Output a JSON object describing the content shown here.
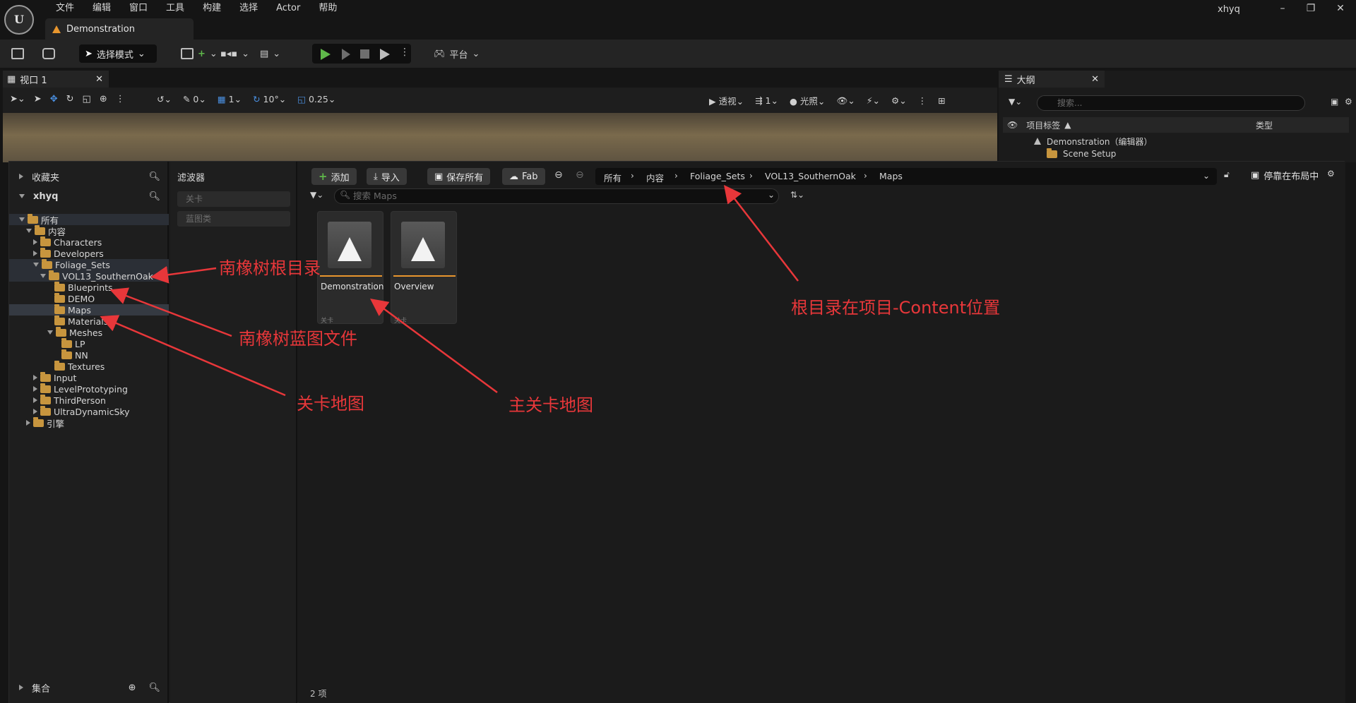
{
  "menu": [
    "文件",
    "编辑",
    "窗口",
    "工具",
    "构建",
    "选择",
    "Actor",
    "帮助"
  ],
  "document_tab": "Demonstration",
  "user": "xhyq",
  "window_controls": [
    "–",
    "❐",
    "✕"
  ],
  "toolbar": {
    "mode_select": "选择模式",
    "platform": "平台"
  },
  "viewport": {
    "tab": "视口 1",
    "snap_move": "0",
    "grid": "1",
    "rotate": "10°",
    "scale": "0.25",
    "view_mode": "透视",
    "camera_speed": "1",
    "lighting": "光照"
  },
  "outliner": {
    "tab": "大纲",
    "search_placeholder": "搜索...",
    "col_label": "项目标签",
    "col_type": "类型",
    "rows": [
      "Demonstration（编辑器）",
      "Scene Setup"
    ]
  },
  "sources": {
    "favorites": "收藏夹",
    "project": "xhyq",
    "collections": "集合",
    "tree": [
      {
        "label": "所有",
        "level": 0,
        "caret": "down"
      },
      {
        "label": "内容",
        "level": 1,
        "caret": "down"
      },
      {
        "label": "Characters",
        "level": 2,
        "caret": "right"
      },
      {
        "label": "Developers",
        "level": 2,
        "caret": "right"
      },
      {
        "label": "Foliage_Sets",
        "level": 2,
        "caret": "down"
      },
      {
        "label": "VOL13_SouthernOak",
        "level": 3,
        "caret": "down"
      },
      {
        "label": "Blueprints",
        "level": 4,
        "caret": "none"
      },
      {
        "label": "DEMO",
        "level": 4,
        "caret": "none"
      },
      {
        "label": "Maps",
        "level": 4,
        "caret": "none"
      },
      {
        "label": "Materials",
        "level": 4,
        "caret": "none"
      },
      {
        "label": "Meshes",
        "level": 4,
        "caret": "down"
      },
      {
        "label": "LP",
        "level": 5,
        "caret": "none"
      },
      {
        "label": "NN",
        "level": 5,
        "caret": "none"
      },
      {
        "label": "Textures",
        "level": 4,
        "caret": "none"
      },
      {
        "label": "Input",
        "level": 2,
        "caret": "right"
      },
      {
        "label": "LevelPrototyping",
        "level": 2,
        "caret": "right"
      },
      {
        "label": "ThirdPerson",
        "level": 2,
        "caret": "right"
      },
      {
        "label": "UltraDynamicSky",
        "level": 2,
        "caret": "right"
      },
      {
        "label": "引擎",
        "level": 1,
        "caret": "right"
      }
    ]
  },
  "filters": {
    "title": "滤波器",
    "chips": [
      "关卡",
      "蓝图类"
    ]
  },
  "content_browser": {
    "add": "添加",
    "import": "导入",
    "save_all": "保存所有",
    "fab": "Fab",
    "breadcrumb": [
      "所有",
      "内容",
      "Foliage_Sets",
      "VOL13_SouthernOak",
      "Maps"
    ],
    "dock_label": "停靠在布局中",
    "search_placeholder": "搜索 Maps",
    "assets": [
      {
        "name": "Demonstration",
        "type": "关卡"
      },
      {
        "name": "Overview",
        "type": "关卡"
      }
    ],
    "item_count": "2 项"
  },
  "annotations": {
    "root_dir": "南橡树根目录",
    "blueprint_files": "南橡树蓝图文件",
    "level_maps": "关卡地图",
    "main_level": "主关卡地图",
    "content_location": "根目录在项目-Content位置"
  },
  "colors": {
    "accent_orange": "#e8962e",
    "annotation_red": "#e8373a",
    "play_green": "#5fb84a",
    "folder": "#c7953e"
  }
}
